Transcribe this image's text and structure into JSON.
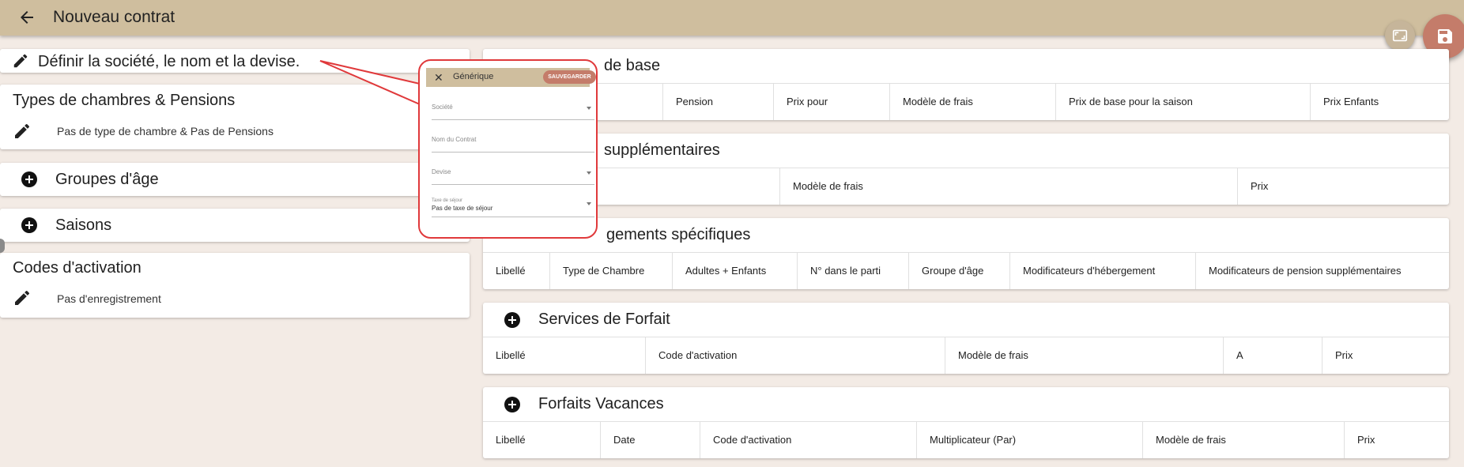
{
  "header": {
    "title": "Nouveau contrat"
  },
  "colors": {
    "topbar": "#cfbe9e",
    "fab_save": "#c47c6a",
    "callout": "#e0393b"
  },
  "icons": {
    "back": "arrow-left-icon",
    "fullscreen": "fullscreen-icon",
    "save": "floppy-disk-icon",
    "edit": "pencil-icon",
    "add": "plus-circle-icon",
    "close": "close-icon"
  },
  "left": {
    "define": {
      "title": "Définir la société, le nom et la devise."
    },
    "room_types": {
      "title": "Types de chambres & Pensions",
      "subtitle": "Pas de type de chambre & Pas de Pensions"
    },
    "age_groups": {
      "title": "Groupes d'âge"
    },
    "seasons": {
      "title": "Saisons"
    },
    "activation": {
      "title": "Codes d'activation",
      "subtitle": "Pas d'enregistrement"
    }
  },
  "popup": {
    "title": "Générique",
    "save_label": "SAUVEGARDER",
    "close_glyph": "✕",
    "fields": [
      {
        "label": "Société",
        "value": ""
      },
      {
        "label": "Nom du Contrat",
        "value": ""
      },
      {
        "label": "Devise",
        "value": ""
      },
      {
        "label": "Taxe de séjour",
        "value": "Pas de taxe de séjour"
      }
    ]
  },
  "panels": [
    {
      "title": "de base",
      "columns": [
        "Pension",
        "Prix pour",
        "Modèle de frais",
        "Prix de base pour la saison",
        "Prix Enfants"
      ]
    },
    {
      "title": "supplémentaires",
      "columns": [
        "Modèle de frais",
        "Prix"
      ]
    },
    {
      "title": "gements spécifiques",
      "columns": [
        "Libellé",
        "Type de Chambre",
        "Adultes + Enfants",
        "N° dans le parti",
        "Groupe d'âge",
        "Modificateurs d'hébergement",
        "Modificateurs de pension supplémentaires"
      ]
    },
    {
      "title": "Services de Forfait",
      "columns": [
        "Libellé",
        "Code d'activation",
        "Modèle de frais",
        "A",
        "Prix"
      ]
    },
    {
      "title": "Forfaits Vacances",
      "columns": [
        "Libellé",
        "Date",
        "Code d'activation",
        "Multiplicateur (Par)",
        "Modèle de frais",
        "Prix"
      ]
    }
  ]
}
